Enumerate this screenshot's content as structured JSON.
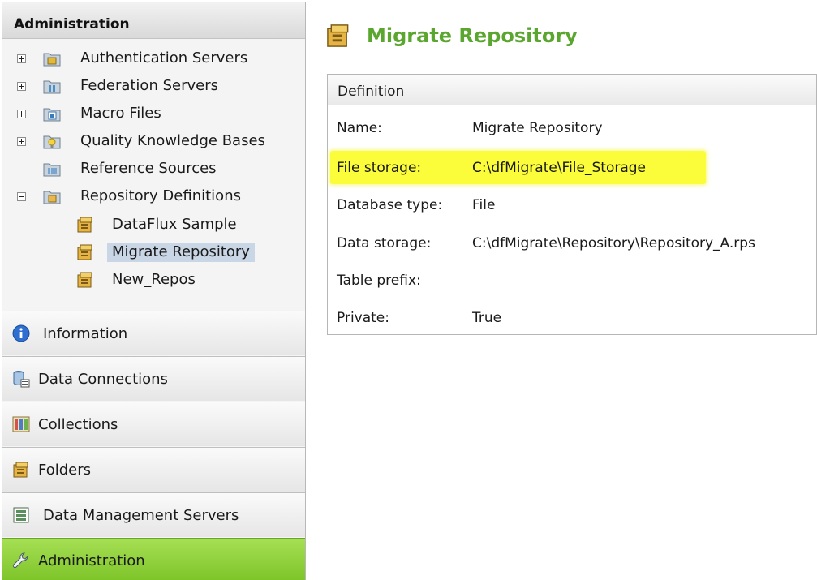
{
  "tree": {
    "header": "Administration",
    "items": [
      {
        "label": "Authentication Servers",
        "expander": "plus",
        "icon": "server-folder-icon"
      },
      {
        "label": "Federation Servers",
        "expander": "plus",
        "icon": "server-folder-icon"
      },
      {
        "label": "Macro Files",
        "expander": "plus",
        "icon": "file-folder-icon"
      },
      {
        "label": "Quality Knowledge Bases",
        "expander": "plus",
        "icon": "lightbulb-folder-icon"
      },
      {
        "label": "Reference Sources",
        "expander": "none",
        "icon": "reference-folder-icon"
      },
      {
        "label": "Repository Definitions",
        "expander": "minus",
        "icon": "repository-folder-icon"
      },
      {
        "label": "DataFlux Sample",
        "expander": "none",
        "icon": "repository-icon"
      },
      {
        "label": "Migrate Repository",
        "expander": "none",
        "icon": "repository-icon",
        "selected": true
      },
      {
        "label": "New_Repos",
        "expander": "none",
        "icon": "repository-icon"
      }
    ]
  },
  "accordion": [
    {
      "label": "Information",
      "icon": "info-icon"
    },
    {
      "label": "Data Connections",
      "icon": "database-icon"
    },
    {
      "label": "Collections",
      "icon": "collections-icon"
    },
    {
      "label": "Folders",
      "icon": "folder-icon"
    },
    {
      "label": "Data Management Servers",
      "icon": "server-icon"
    },
    {
      "label": "Administration",
      "icon": "wrench-icon",
      "active": true
    }
  ],
  "detail": {
    "title": "Migrate Repository",
    "section": "Definition",
    "properties": [
      {
        "label": "Name:",
        "value": "Migrate Repository"
      },
      {
        "label": "File storage:",
        "value": "C:\\dfMigrate\\File_Storage",
        "highlighted": true
      },
      {
        "label": "Database type:",
        "value": "File"
      },
      {
        "label": "Data storage:",
        "value": "C:\\dfMigrate\\Repository\\Repository_A.rps"
      },
      {
        "label": "Table prefix:",
        "value": ""
      },
      {
        "label": "Private:",
        "value": "True"
      }
    ]
  },
  "colors": {
    "title_green": "#5aa62e",
    "active_tab_green": "#8bcf36",
    "highlight_yellow": "#fbfc3a",
    "selection_blue": "#c9d6e6"
  }
}
